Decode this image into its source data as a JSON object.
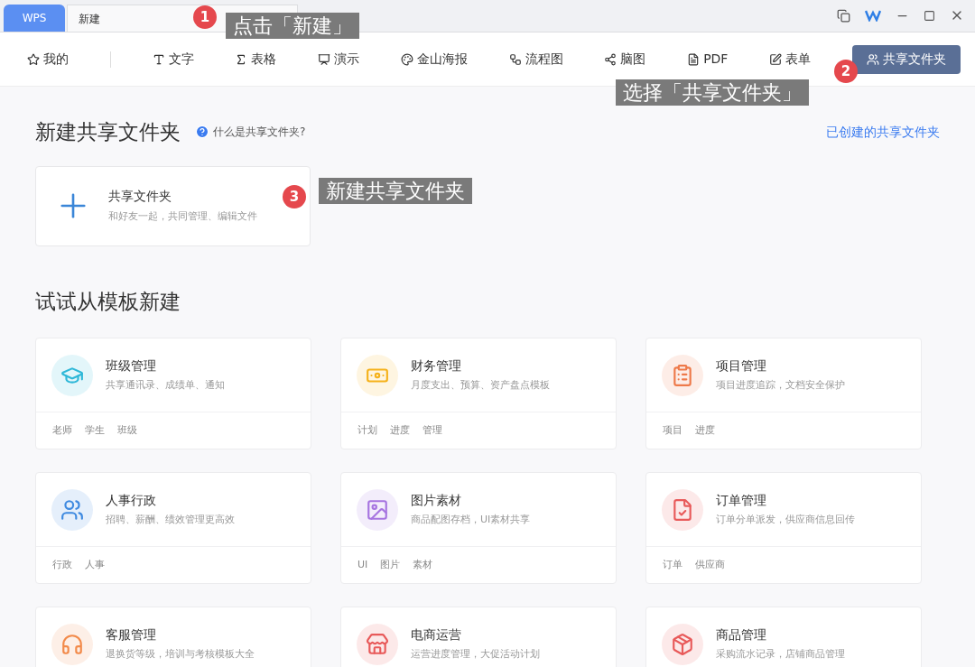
{
  "title_bar": {
    "tabs": [
      {
        "kind": "home",
        "label": "WPS",
        "selected": false
      },
      {
        "kind": "doc",
        "label": "新建",
        "selected": true
      }
    ]
  },
  "nav": {
    "items": [
      {
        "label": "我的",
        "selected": false
      },
      {
        "label": "文字",
        "selected": false
      },
      {
        "label": "表格",
        "selected": false
      },
      {
        "label": "演示",
        "selected": false
      },
      {
        "label": "金山海报",
        "selected": false
      },
      {
        "label": "流程图",
        "selected": false
      },
      {
        "label": "脑图",
        "selected": false
      },
      {
        "label": "PDF",
        "selected": false
      },
      {
        "label": "表单",
        "selected": false
      },
      {
        "label": "共享文件夹",
        "selected": true
      }
    ]
  },
  "shared_section": {
    "title": "新建共享文件夹",
    "help_link": "什么是共享文件夹?",
    "created_link": "已创建的共享文件夹",
    "card": {
      "title": "共享文件夹",
      "description": "和好友一起，共同管理、编辑文件"
    }
  },
  "templates_section": {
    "title": "试试从模板新建",
    "templates": [
      {
        "title": "班级管理",
        "description": "共享通讯录、成绩单、通知",
        "tags": [
          "老师",
          "学生",
          "班级"
        ],
        "color": "#2fb8d8"
      },
      {
        "title": "财务管理",
        "description": "月度支出、预算、资产盘点模板",
        "tags": [
          "计划",
          "进度",
          "管理"
        ],
        "color": "#f5b21c"
      },
      {
        "title": "项目管理",
        "description": "项目进度追踪，文档安全保护",
        "tags": [
          "项目",
          "进度"
        ],
        "color": "#ee7a4a"
      },
      {
        "title": "人事行政",
        "description": "招聘、薪酬、绩效管理更高效",
        "tags": [
          "行政",
          "人事"
        ],
        "color": "#3f8ae0"
      },
      {
        "title": "图片素材",
        "description": "商品配图存档，UI素材共享",
        "tags": [
          "UI",
          "图片",
          "素材"
        ],
        "color": "#a775e0"
      },
      {
        "title": "订单管理",
        "description": "订单分单派发，供应商信息回传",
        "tags": [
          "订单",
          "供应商"
        ],
        "color": "#e85a5a"
      },
      {
        "title": "客服管理",
        "description": "退换货等级，培训与考核模板大全",
        "color": "#f28a4a"
      },
      {
        "title": "电商运营",
        "description": "运营进度管理，大促活动计划",
        "color": "#e85a5a"
      },
      {
        "title": "商品管理",
        "description": "采购流水记录，店铺商品管理",
        "color": "#e85a5a"
      }
    ]
  },
  "annotations": [
    {
      "number": "1",
      "text": "点击「新建」"
    },
    {
      "number": "2",
      "text": "选择「共享文件夹」"
    },
    {
      "number": "3",
      "text": "新建共享文件夹"
    }
  ]
}
